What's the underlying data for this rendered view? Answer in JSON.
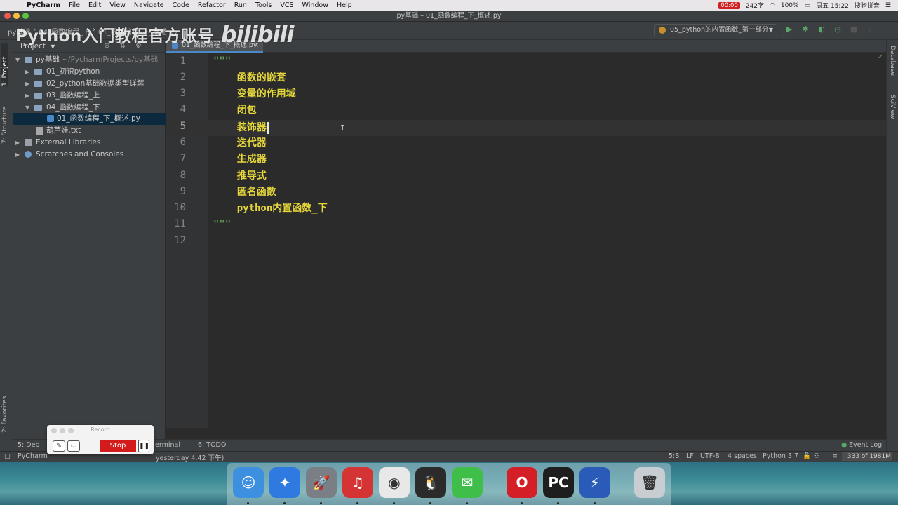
{
  "menubar": {
    "app_name": "PyCharm",
    "items": [
      "File",
      "Edit",
      "View",
      "Navigate",
      "Code",
      "Refactor",
      "Run",
      "Tools",
      "VCS",
      "Window",
      "Help"
    ],
    "status": {
      "recording_time": "00:00",
      "word_count": "242字",
      "battery": "100%",
      "datetime": "周五 15:22",
      "input_method": "搜狗拼音"
    }
  },
  "window": {
    "title": "py基础 – 01_函数编程_下_概述.py"
  },
  "toolbar": {
    "breadcrumb": [
      "py基础",
      "04_函数编程_下",
      "01_函数编程_下_概述.py"
    ],
    "watermark_text": "Python入门教程官方账号",
    "watermark_logo": "bilibili",
    "run_config": "05_python的内置函数_第一部分"
  },
  "left_stripe": {
    "project_tab": "1: Project",
    "structure_tab": "7: Structure",
    "favorites_tab": "2: Favorites"
  },
  "project_panel": {
    "header": "Project",
    "tree": [
      {
        "label": "py基础",
        "sub": "~/PycharmProjects/py基础",
        "kind": "folder",
        "depth": 0,
        "open": true
      },
      {
        "label": "01_初识python",
        "kind": "folder",
        "depth": 1,
        "open": false
      },
      {
        "label": "02_python基础数据类型详解",
        "kind": "folder",
        "depth": 1,
        "open": false
      },
      {
        "label": "03_函数编程_上",
        "kind": "folder",
        "depth": 1,
        "open": false
      },
      {
        "label": "04_函数编程_下",
        "kind": "folder",
        "depth": 1,
        "open": true
      },
      {
        "label": "01_函数编程_下_概述.py",
        "kind": "py",
        "depth": 2,
        "selected": true
      },
      {
        "label": "葫芦娃.txt",
        "kind": "txt",
        "depth": 1
      },
      {
        "label": "External Libraries",
        "kind": "lib",
        "depth": 0,
        "open": false
      },
      {
        "label": "Scratches and Consoles",
        "kind": "scratch",
        "depth": 0,
        "open": false
      }
    ]
  },
  "editor": {
    "tab_label": "01_函数编程_下_概述.py",
    "current_line": 5,
    "lines": [
      {
        "n": "1",
        "text": "\"\"\"",
        "kind": "quote"
      },
      {
        "n": "2",
        "text": "    函数的嵌套",
        "kind": "doc"
      },
      {
        "n": "3",
        "text": "    变量的作用域",
        "kind": "doc"
      },
      {
        "n": "4",
        "text": "    闭包",
        "kind": "doc"
      },
      {
        "n": "5",
        "text": "    装饰器",
        "kind": "doc"
      },
      {
        "n": "6",
        "text": "    迭代器",
        "kind": "doc"
      },
      {
        "n": "7",
        "text": "    生成器",
        "kind": "doc"
      },
      {
        "n": "8",
        "text": "    推导式",
        "kind": "doc"
      },
      {
        "n": "9",
        "text": "    匿名函数",
        "kind": "doc"
      },
      {
        "n": "10",
        "text": "    python内置函数_下",
        "kind": "doc"
      },
      {
        "n": "11",
        "text": "\"\"\"",
        "kind": "quote"
      },
      {
        "n": "12",
        "text": "",
        "kind": "doc"
      }
    ]
  },
  "right_stripe": {
    "database_tab": "Database",
    "sciview_tab": "SciView"
  },
  "bottom_tools": {
    "debug": "5: Deb",
    "terminal": "erminal",
    "todo": "6: TODO",
    "event_log": "Event Log"
  },
  "status_bar": {
    "message": "PyCharm",
    "message_tail": "yesterday 4:42 下午)",
    "position": "5:8",
    "line_sep": "LF",
    "encoding": "UTF-8",
    "indent": "4 spaces",
    "interpreter": "Python 3.7",
    "memory": "333 of 1981M"
  },
  "record_widget": {
    "title": "Record",
    "stop_label": "Stop"
  },
  "dock": {
    "apps": [
      {
        "name": "Finder",
        "glyph": "☺",
        "color": "#3d8fe0"
      },
      {
        "name": "Safari",
        "glyph": "✦",
        "color": "#2f7ae0"
      },
      {
        "name": "Launchpad",
        "glyph": "🚀",
        "color": "#7a7f86"
      },
      {
        "name": "NetEase Music",
        "glyph": "♫",
        "color": "#d53434"
      },
      {
        "name": "Chrome",
        "glyph": "◉",
        "color": "#e8e8e8"
      },
      {
        "name": "QQ",
        "glyph": "🐧",
        "color": "#2b2b2b"
      },
      {
        "name": "WeChat",
        "glyph": "✉",
        "color": "#3fbf4a"
      },
      {
        "name": "Opera",
        "glyph": "O",
        "color": "#d41f27"
      },
      {
        "name": "PyCharm",
        "glyph": "PC",
        "color": "#1e1e1e"
      },
      {
        "name": "Reeder",
        "glyph": "⚡",
        "color": "#2a5bb8"
      },
      {
        "name": "Trash",
        "glyph": "🗑",
        "color": "#c8cdd2"
      }
    ]
  }
}
